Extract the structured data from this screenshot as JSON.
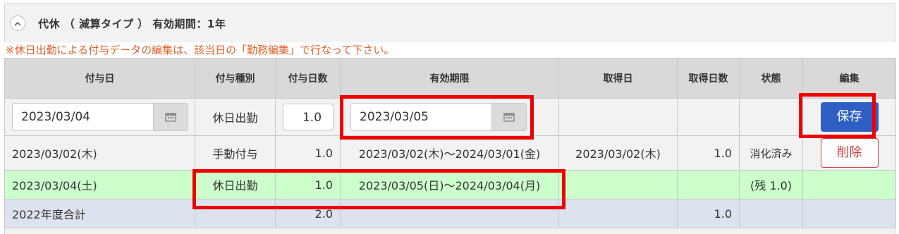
{
  "section": {
    "title": "代休 （ 減算タイプ ） 有効期間：1年"
  },
  "notice": "※休日出勤による付与データの編集は、該当日の「勤務編集」で行なって下さい。",
  "columns": [
    "付与日",
    "付与種別",
    "付与日数",
    "有効期限",
    "取得日",
    "取得日数",
    "状態",
    "編集"
  ],
  "edit_row": {
    "grant_date": "2023/03/04",
    "grant_type": "休日出勤",
    "grant_days": "1.0",
    "expiry_date": "2023/03/05",
    "save_label": "保存"
  },
  "rows": [
    {
      "grant_date": "2023/03/02(木)",
      "grant_type": "手動付与",
      "grant_days": "1.0",
      "expiry": "2023/03/02(木)～2024/03/01(金)",
      "taken_date": "2023/03/02(木)",
      "taken_days": "1.0",
      "status": "消化済み",
      "delete_label": "削除"
    },
    {
      "grant_date": "2023/03/04(土)",
      "grant_type": "休日出勤",
      "grant_days": "1.0",
      "expiry": "2023/03/05(日)～2024/03/04(月)",
      "taken_date": "",
      "taken_days": "",
      "status": "(残 1.0)"
    }
  ],
  "total": {
    "label": "2022年度合計",
    "grant_days": "2.0",
    "taken_days": "1.0"
  },
  "colors": {
    "accent": "#2f5fc4",
    "highlight": "#ee0000",
    "new_row": "#ccffcc",
    "notice": "#e0612a"
  }
}
